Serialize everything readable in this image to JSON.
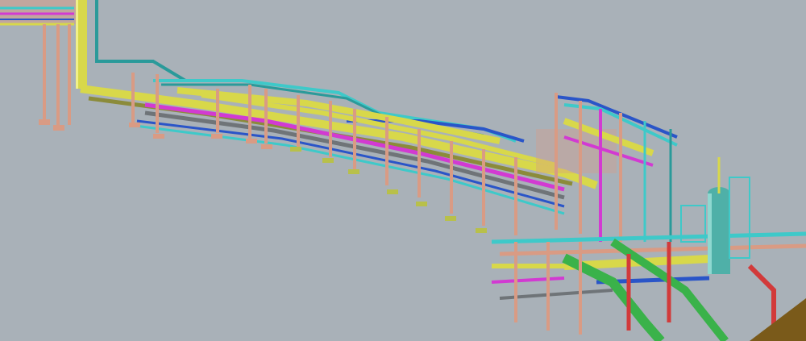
{
  "scene": {
    "background": "#a9b1b8",
    "palette": {
      "structural_steel": "#d99b84",
      "yellow_pipe": "#d8d84a",
      "olive_pipe": "#8b8b3a",
      "cyan_pipe": "#3ec9c9",
      "teal_pipe": "#2a9a9a",
      "blue_pipe": "#2a55c8",
      "magenta_pipe": "#d23ad2",
      "green_pipe": "#3ab24a",
      "red_pipe": "#d23a3a",
      "grey_pipe": "#6f7478",
      "concrete_footing": "#b8c04a",
      "vessel": "#4fb0a8",
      "ground_mound": "#7a5a1a"
    },
    "icons": [
      "pipe-rack",
      "pressure-vessel",
      "support-column",
      "footing"
    ]
  }
}
